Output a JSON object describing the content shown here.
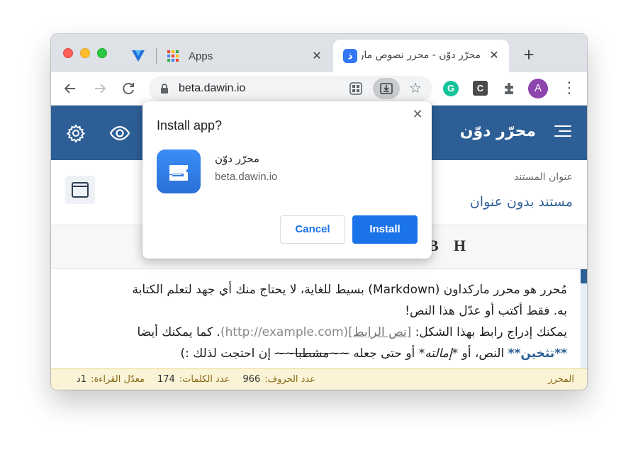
{
  "tabs": {
    "apps_title": "Apps",
    "active_title": "محرّر دوّن - محرر نصوص ماركداون",
    "active_favicon": "ذ"
  },
  "toolbar": {
    "url": "beta.dawin.io",
    "ext_grammarly": "G",
    "ext_c": "C",
    "avatar": "A"
  },
  "app": {
    "title": "محرّر دوّن",
    "doc_label": "عنوان المستند",
    "doc_title": "مستند بدون عنوان"
  },
  "format_buttons": [
    "B",
    "H"
  ],
  "editor": {
    "line1": "مُحرر هو محرر ماركداون (Markdown) بسيط للغاية، لا يحتاج منك أي جهد لتعلم الكتابة",
    "line2": "به. فقط أكتب أو عدّل هذا النص!",
    "line3_pre": "يمكنك إدراج رابط بهذا الشكل: ",
    "link_text": "[نص الرابط]",
    "link_url": "(http://example.com)",
    "line3_post": ". كما يمكنك أيضا",
    "bold": "**تثخين**",
    "line4_mid1": " النص، أو ",
    "italic": "*إمالته*",
    "line4_mid2": " أو حتى جعله ",
    "strike": "~~مشطبا~~",
    "line4_end": " إن احتجت لذلك :)"
  },
  "status": {
    "mode": "المحرر",
    "chars_label": "عدد الحروف:",
    "chars_value": "966",
    "words_label": "عدد الكلمات:",
    "words_value": "174",
    "reading_label": "معدّل القراءة:",
    "reading_value": "1د"
  },
  "popup": {
    "title": "Install app?",
    "app_name": "محرّر دوّن",
    "domain": "beta.dawin.io",
    "cancel": "Cancel",
    "install": "Install"
  },
  "colors": {
    "header": "#2d5f96",
    "install_button": "#1a73e8",
    "status_bar": "#fbf3d5"
  }
}
